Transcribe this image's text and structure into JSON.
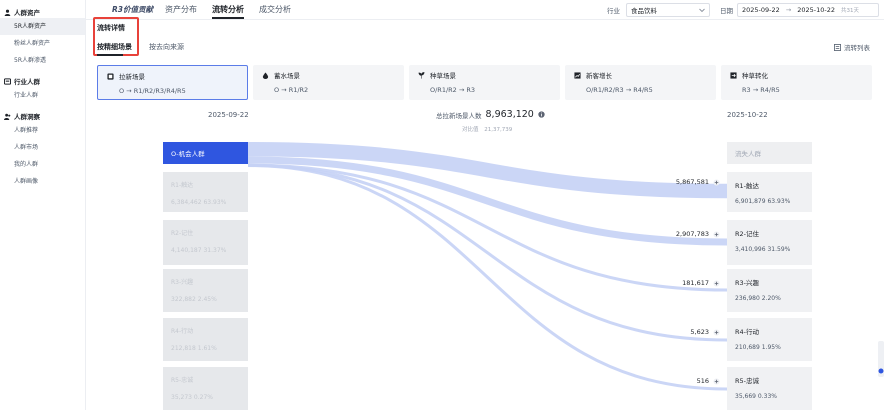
{
  "sidebar": {
    "groups": [
      {
        "label": "人群资产",
        "icon": "people-icon",
        "items": [
          "5R人群资产",
          "粉丝人群资产",
          "5R人群渗透"
        ],
        "active": 0
      },
      {
        "label": "行业人群",
        "icon": "industry-icon",
        "items": [
          "行业人群"
        ]
      },
      {
        "label": "人群洞察",
        "icon": "insight-icon",
        "items": [
          "人群推荐",
          "人群市场",
          "我的人群",
          "人群画像"
        ]
      }
    ]
  },
  "topbar": {
    "brand": "R3价值贡献",
    "tabs": [
      "资产分布",
      "流转分析",
      "成交分析"
    ],
    "active_tab": 1,
    "industry_label": "行业",
    "industry_value": "食品饮料",
    "date_label": "日期",
    "date_start": "2025-09-22",
    "date_sep": "→",
    "date_end": "2025-10-22",
    "date_suffix": "共31天"
  },
  "subtabs": {
    "title": "流转详情",
    "by_scene": "按精细场景",
    "by_source": "按去向来源",
    "list_label": "流转列表"
  },
  "scenes": [
    {
      "title": "拉新场景",
      "path": "O → R1/R2/R3/R4/R5",
      "active": true,
      "icon": "acquire-icon"
    },
    {
      "title": "蓄水场景",
      "path": "O → R1/R2",
      "icon": "water-drop-icon"
    },
    {
      "title": "种草场景",
      "path": "O/R1/R2 → R3",
      "icon": "seed-icon"
    },
    {
      "title": "新客增长",
      "path": "O/R1/R2/R3 → R4/R5",
      "icon": "growth-icon"
    },
    {
      "title": "种草转化",
      "path": "R3 → R4/R5",
      "icon": "convert-icon"
    }
  ],
  "flow": {
    "date_left": "2025-09-22",
    "date_right": "2025-10-22",
    "total_label": "总拉新场景人数",
    "total_value": "8,963,120",
    "sub_label": "对比值",
    "sub_value": "21,37,739",
    "left_nodes": [
      {
        "name": "O-机会人群",
        "highlight": true
      },
      {
        "name": "R1-触达",
        "value": "6,384,462",
        "pct": "63.93%"
      },
      {
        "name": "R2-记住",
        "value": "4,140,187",
        "pct": "31.37%"
      },
      {
        "name": "R3-兴趣",
        "value": "322,882",
        "pct": "2.45%"
      },
      {
        "name": "R4-行动",
        "value": "212,818",
        "pct": "1.61%"
      },
      {
        "name": "R5-忠诚",
        "value": "35,273",
        "pct": "0.27%"
      }
    ],
    "right_nodes": [
      {
        "name": "流失人群",
        "empty": true
      },
      {
        "name": "R1-触达",
        "value": "6,901,879",
        "pct": "63.93%"
      },
      {
        "name": "R2-记住",
        "value": "3,410,996",
        "pct": "31.59%"
      },
      {
        "name": "R3-兴趣",
        "value": "236,980",
        "pct": "2.20%"
      },
      {
        "name": "R4-行动",
        "value": "210,689",
        "pct": "1.95%"
      },
      {
        "name": "R5-忠诚",
        "value": "35,669",
        "pct": "0.33%"
      }
    ],
    "flows": [
      {
        "to": "R1-触达",
        "value": "5,867,581",
        "weight": 5867581
      },
      {
        "to": "R2-记住",
        "value": "2,907,783",
        "weight": 2907783
      },
      {
        "to": "R3-兴趣",
        "value": "181,617",
        "weight": 181617
      },
      {
        "to": "R4-行动",
        "value": "5,623",
        "weight": 5623
      },
      {
        "to": "R5-忠诚",
        "value": "516",
        "weight": 516
      }
    ],
    "flow_color": "#c5d1f5",
    "accent": "#2f56e0"
  }
}
